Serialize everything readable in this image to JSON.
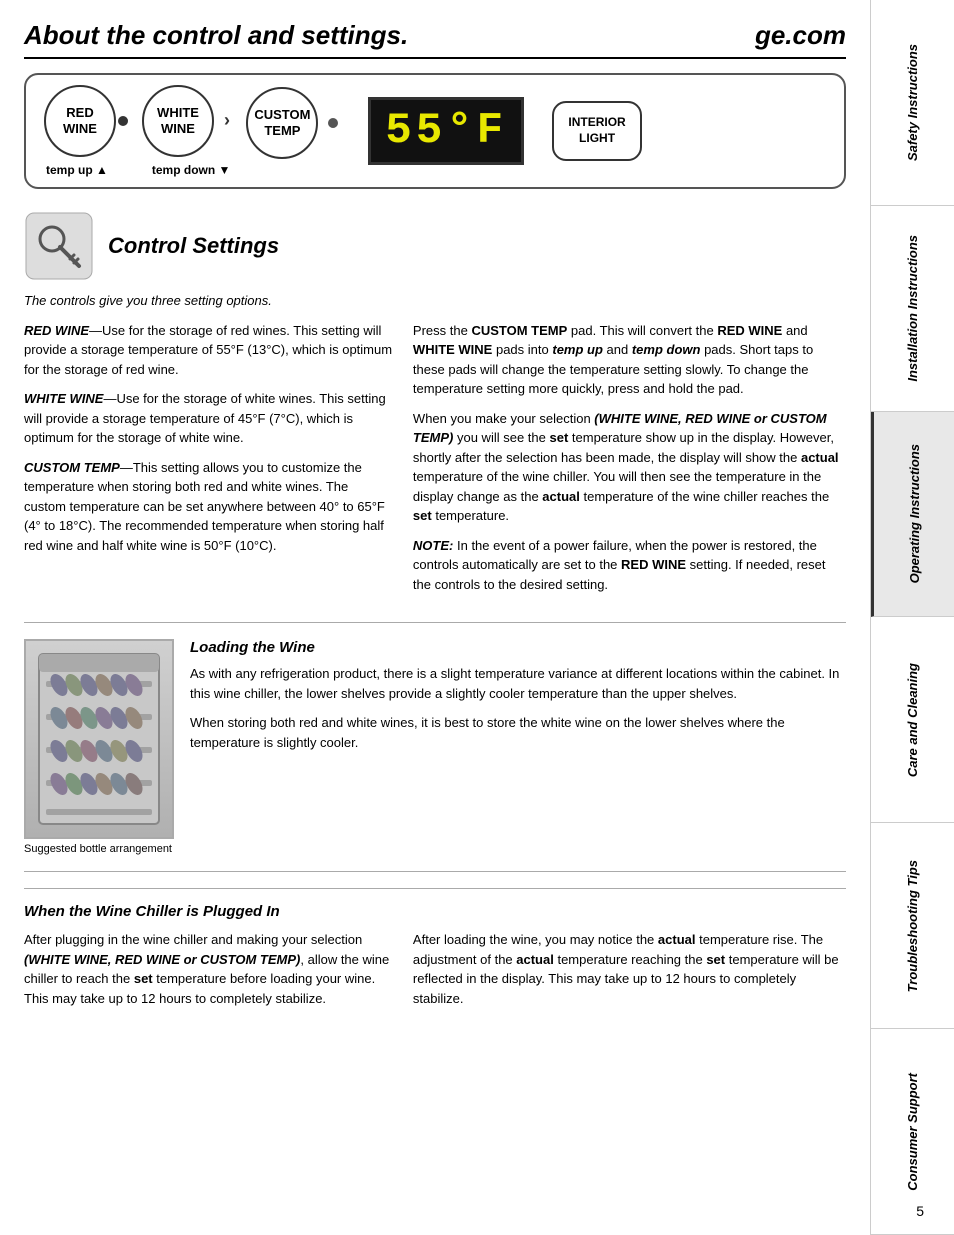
{
  "page": {
    "title": "About the control and settings.",
    "ge_com": "ge.com",
    "page_number": "5"
  },
  "control_panel": {
    "red_wine_line1": "RED",
    "red_wine_line2": "WINE",
    "white_wine_line1": "WHITE",
    "white_wine_line2": "WINE",
    "custom_temp_line1": "CUSTOM",
    "custom_temp_line2": "TEMP",
    "display": "55°F",
    "interior_light_line1": "INTERIOR",
    "interior_light_line2": "LIGHT",
    "temp_up": "temp up ▲",
    "temp_down": "temp down ▼"
  },
  "section_title": "Control Settings",
  "intro": "The controls give you three setting options.",
  "left_col": {
    "red_wine_heading": "RED WINE",
    "red_wine_body": "—Use for the storage of red wines. This setting will provide a storage temperature of 55°F (13°C), which is optimum for the storage of red wine.",
    "white_wine_heading": "WHITE WINE",
    "white_wine_body": "—Use for the storage of white wines. This setting will provide a storage temperature of 45°F (7°C), which is optimum for the storage of white wine.",
    "custom_temp_heading": "CUSTOM TEMP",
    "custom_temp_body": "—This setting allows you to customize the temperature when storing both red and white wines. The custom temperature can be set anywhere between 40° to 65°F (4° to 18°C). The recommended temperature when storing half red wine and half white wine is 50°F (10°C)."
  },
  "right_col": {
    "p1": "Press the CUSTOM TEMP pad. This will convert the RED WINE and WHITE WINE pads into temp up and temp down pads. Short taps to these pads will change the temperature setting slowly. To change the temperature setting more quickly, press and hold the pad.",
    "p2_pre": "When you make your selection ",
    "p2_selection": "(WHITE WINE, RED WINE or CUSTOM TEMP)",
    "p2_mid": " you will see the ",
    "p2_set": "set",
    "p2_after": " temperature show up in the display. However, shortly after the selection has been made, the display will show the ",
    "p2_actual": "actual",
    "p2_end": " temperature of the wine chiller. You will then see the temperature in the display change as the ",
    "p2_actual2": "actual",
    "p2_end2": " temperature of the wine chiller reaches the ",
    "p2_set2": "set",
    "p2_end3": " temperature.",
    "note_label": "NOTE:",
    "note_body": " In the event of a power failure, when the power is restored, the controls automatically are set to the RED WINE setting. If needed, reset the controls to the desired setting."
  },
  "loading_section": {
    "title": "Loading the Wine",
    "caption": "Suggested bottle arrangement",
    "p1": "As with any refrigeration product, there is a slight temperature variance at different locations within the cabinet. In this wine chiller, the lower shelves provide a slightly cooler temperature than the upper shelves.",
    "p2": "When storing both red and white wines, it is best to store the white wine on the lower shelves where the temperature is slightly cooler."
  },
  "plugged_section": {
    "title": "When the Wine Chiller is Plugged In",
    "left_p1_pre": "After plugging in the wine chiller and making your selection ",
    "left_p1_selection": "(WHITE WINE, RED WINE or CUSTOM TEMP)",
    "left_p1_end": ", allow the wine chiller to reach the ",
    "left_p1_set": "set",
    "left_p1_end2": " temperature before loading your wine. This may take up to 12 hours to completely stabilize.",
    "right_p1_pre": "After loading the wine, you may notice the ",
    "right_p1_actual": "actual",
    "right_p1_mid": " temperature rise. The adjustment of the ",
    "right_p1_actual2": "actual",
    "right_p1_end": " temperature reaching the ",
    "right_p1_set": "set",
    "right_p1_end2": " temperature will be reflected in the display. This may take up to 12 hours to completely stabilize."
  },
  "sidebar": {
    "tabs": [
      "Safety Instructions",
      "Installation Instructions",
      "Operating Instructions",
      "Care and Cleaning",
      "Troubleshooting Tips",
      "Consumer Support"
    ]
  }
}
